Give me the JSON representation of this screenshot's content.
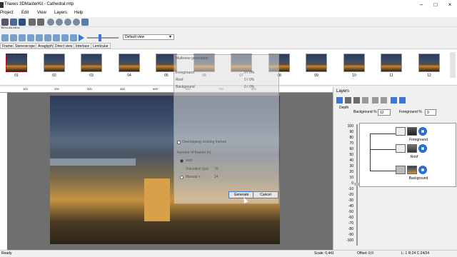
{
  "window": {
    "title": "Triaxes 3DMasterKit - Cathedral.mtp"
  },
  "menu": [
    "Project",
    "Edit",
    "View",
    "Layers",
    "Help"
  ],
  "toolbar": {
    "view_select": "Default view",
    "navigator_label": "Navigator"
  },
  "tabs": [
    "Frames",
    "Stereoscope",
    "Anaglyph",
    "Direct view",
    "Interlace",
    "Lenticular"
  ],
  "frames": [
    "01",
    "02",
    "03",
    "04",
    "05",
    "06",
    "07",
    "08",
    "09",
    "10",
    "11",
    "12"
  ],
  "ruler": {
    "labels": [
      "100",
      "200",
      "300",
      "400",
      "500",
      "600",
      "700",
      "800"
    ]
  },
  "dialog": {
    "title": "Multiview generation",
    "rows": [
      {
        "name": "Foreground",
        "value": "0 / 0%"
      },
      {
        "name": "Roof",
        "value": "0 / 0%"
      },
      {
        "name": "Background",
        "value": "0 / 0%"
      }
    ],
    "overwrite_label": "Overlapping existing frames",
    "frames_group": "Number of frames (n)",
    "auto_label": "auto",
    "transition_label": "Transition (px)",
    "transition_value": "70",
    "manual_label": "Manual n",
    "manual_value": "24",
    "generate": "Generate",
    "cancel": "Cancel"
  },
  "layers_panel": {
    "title": "Layers",
    "depth_label": "Depth",
    "bg_label": "Background %",
    "bg_value": "12",
    "fg_label": "Foreground %",
    "fg_value": "9",
    "scale": [
      "100",
      "90",
      "80",
      "70",
      "60",
      "50",
      "40",
      "30",
      "20",
      "10",
      "0",
      "-10",
      "-20",
      "-30",
      "-40",
      "-50",
      "-60",
      "-70",
      "-80",
      "-90",
      "-100"
    ],
    "layers": [
      "Foreground",
      "Roof",
      "Background"
    ]
  },
  "status": {
    "left": "Ready",
    "scale": "Scale: 0,441",
    "offset": "Offset: 0;0",
    "info": "L: 1  R:24  C:24/24"
  },
  "colors": {
    "eye": "#2a6ed9",
    "workspace": "#6f6f6f",
    "accent": "#3a78d6"
  }
}
